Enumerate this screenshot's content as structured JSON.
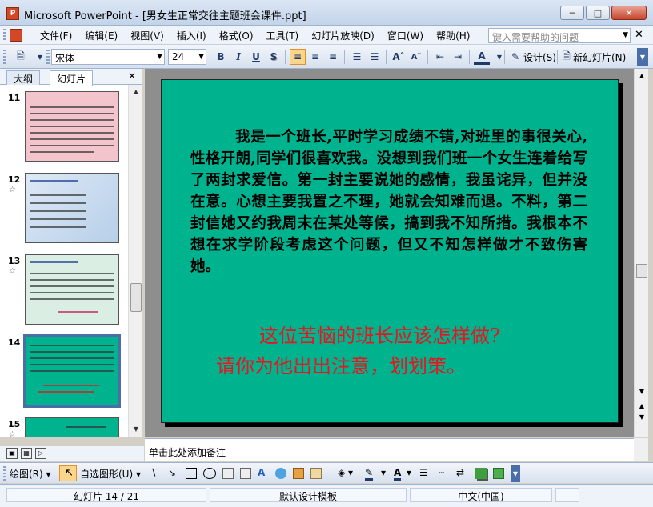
{
  "window": {
    "title": "Microsoft PowerPoint - [男女生正常交往主题班会课件.ppt]",
    "app_icon_text": "P"
  },
  "menu": {
    "items": [
      "文件(F)",
      "编辑(E)",
      "视图(V)",
      "插入(I)",
      "格式(O)",
      "工具(T)",
      "幻灯片放映(D)",
      "窗口(W)",
      "帮助(H)"
    ],
    "help_placeholder": "键入需要帮助的问题"
  },
  "toolbar": {
    "font_name": "宋体",
    "font_size": "24",
    "bold": "B",
    "italic": "I",
    "underline": "U",
    "shadow": "S",
    "design_label": "设计(S)",
    "new_slide_label": "新幻灯片(N)"
  },
  "panel": {
    "tabs": [
      "大纲",
      "幻灯片"
    ],
    "thumbnails": [
      {
        "number": "11",
        "has_star": false,
        "bg": "#f4c4cc"
      },
      {
        "number": "12",
        "has_star": true,
        "bg": "#c9ddf2"
      },
      {
        "number": "13",
        "has_star": true,
        "bg": "#d7ebe0"
      },
      {
        "number": "14",
        "has_star": false,
        "bg": "#00b38f",
        "selected": true
      },
      {
        "number": "15",
        "has_star": true,
        "bg": "#00b38f"
      }
    ]
  },
  "slide": {
    "body": "我是一个班长,平时学习成绩不错,对班里的事很关心,性格开朗,同学们很喜欢我。没想到我们班一个女生连着给写了两封求爱信。第一封主要说她的感情，我虽诧异，但并没在意。心想主要我置之不理，她就会知难而退。不料，第二封信她又约我周末在某处等候，搞到我不知所措。我根本不想在求学阶段考虑这个问题，但又不知怎样做才不致伤害她。",
    "question_line1": "这位苦恼的班长应该怎样做?",
    "question_line2": "请你为他出出注意，划划策。",
    "bg_color": "#00b38f",
    "question_color": "#e8141e"
  },
  "notes": {
    "placeholder": "单击此处添加备注"
  },
  "drawing": {
    "draw_label": "绘图(R)",
    "autoshapes_label": "自选图形(U)"
  },
  "status": {
    "slide_pos": "幻灯片 14 / 21",
    "template": "默认设计模板",
    "language": "中文(中国)"
  }
}
